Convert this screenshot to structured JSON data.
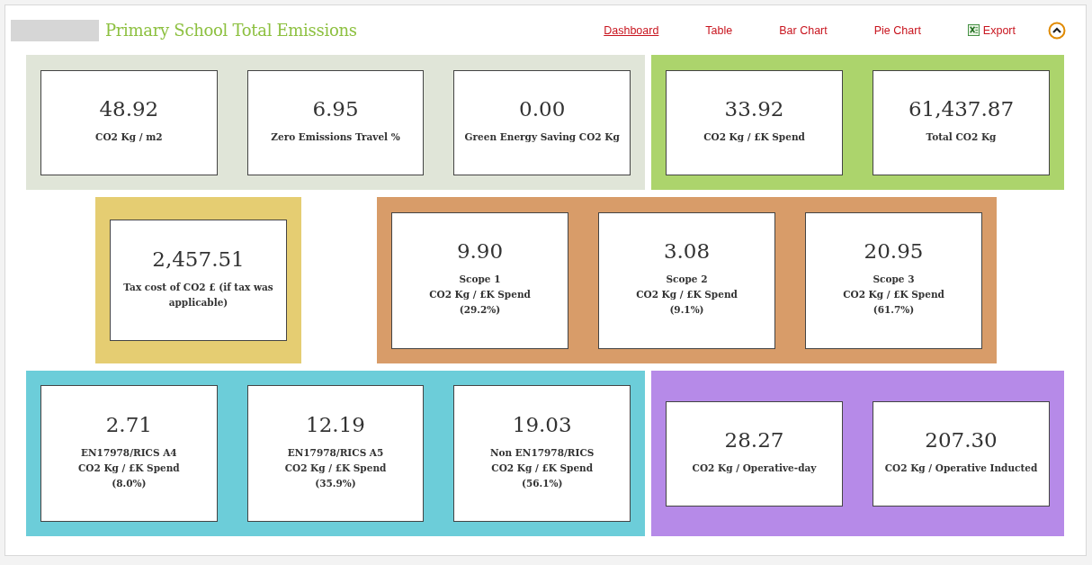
{
  "header": {
    "title": "Primary School Total Emissions",
    "nav": [
      {
        "label": "Dashboard",
        "selected": true,
        "kind": "link"
      },
      {
        "label": "Table",
        "selected": false,
        "kind": "link"
      },
      {
        "label": "Bar Chart",
        "selected": false,
        "kind": "link"
      },
      {
        "label": "Pie Chart",
        "selected": false,
        "kind": "link"
      },
      {
        "label": "Export",
        "selected": false,
        "kind": "export"
      }
    ]
  },
  "rows": [
    {
      "groups": [
        {
          "color": "#e0e5d8",
          "cards": [
            {
              "value": "48.92",
              "label": [
                "CO2 Kg / m2"
              ]
            },
            {
              "value": "6.95",
              "label": [
                "Zero Emissions Travel %"
              ]
            },
            {
              "value": "0.00",
              "label": [
                "Green Energy Saving CO2 Kg"
              ]
            }
          ]
        },
        {
          "color": "#acd46c",
          "cards": [
            {
              "value": "33.92",
              "label": [
                "CO2 Kg / £K Spend"
              ]
            },
            {
              "value": "61,437.87",
              "label": [
                "Total CO2 Kg"
              ]
            }
          ]
        }
      ]
    },
    {
      "groups": [
        {
          "color": "#e5cd72",
          "cards": [
            {
              "value": "2,457.51",
              "label": [
                "Tax cost of CO2 £ (if tax was applicable)"
              ]
            }
          ]
        },
        {
          "color": "#d89c69",
          "cards": [
            {
              "value": "9.90",
              "label": [
                "Scope 1",
                "CO2 Kg / £K Spend",
                "(29.2%)"
              ]
            },
            {
              "value": "3.08",
              "label": [
                "Scope 2",
                "CO2 Kg / £K Spend",
                "(9.1%)"
              ]
            },
            {
              "value": "20.95",
              "label": [
                "Scope 3",
                "CO2 Kg / £K Spend",
                "(61.7%)"
              ]
            }
          ]
        }
      ]
    },
    {
      "groups": [
        {
          "color": "#6ccdd9",
          "cards": [
            {
              "value": "2.71",
              "label": [
                "EN17978/RICS A4",
                "CO2 Kg / £K Spend",
                "(8.0%)"
              ]
            },
            {
              "value": "12.19",
              "label": [
                "EN17978/RICS A5",
                "CO2 Kg / £K Spend",
                "(35.9%)"
              ]
            },
            {
              "value": "19.03",
              "label": [
                "Non EN17978/RICS",
                "CO2 Kg / £K Spend",
                "(56.1%)"
              ]
            }
          ]
        },
        {
          "color": "#b68ae8",
          "cards": [
            {
              "value": "28.27",
              "label": [
                "CO2 Kg / Operative-day"
              ]
            },
            {
              "value": "207.30",
              "label": [
                "CO2 Kg / Operative Inducted"
              ]
            }
          ]
        }
      ]
    }
  ]
}
